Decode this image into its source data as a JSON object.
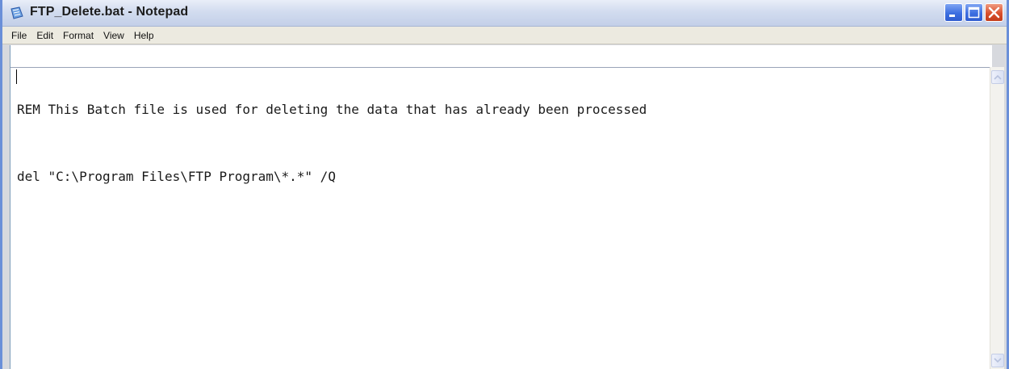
{
  "window": {
    "title": "FTP_Delete.bat - Notepad"
  },
  "menu": {
    "items": [
      {
        "label": "File"
      },
      {
        "label": "Edit"
      },
      {
        "label": "Format"
      },
      {
        "label": "View"
      },
      {
        "label": "Help"
      }
    ]
  },
  "editor": {
    "lines": [
      "REM This Batch file is used for deleting the data that has already been processed",
      "del \"C:\\Program Files\\FTP Program\\*.*\" /Q"
    ]
  },
  "icons": {
    "app": "notepad-icon",
    "minimize": "minimize-icon",
    "maximize": "maximize-icon",
    "close": "close-icon",
    "scroll_up": "scroll-up-arrow-icon",
    "scroll_down": "scroll-down-arrow-icon"
  },
  "colors": {
    "titlebar": "#c3cfe8",
    "close_button": "#d9502d",
    "min_max_button": "#3c6ee0",
    "menubar": "#eceae0"
  }
}
